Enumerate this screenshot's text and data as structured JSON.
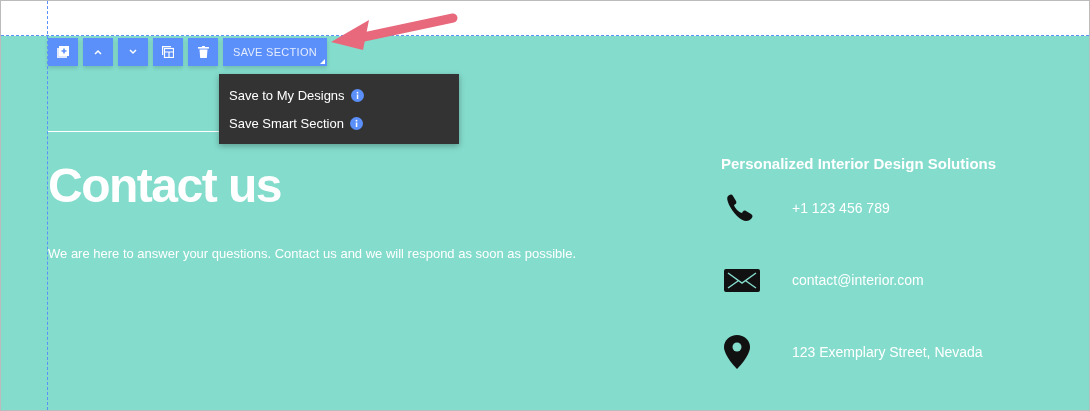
{
  "toolbar": {
    "buttons": [
      {
        "kind": "add"
      },
      {
        "kind": "up"
      },
      {
        "kind": "down"
      },
      {
        "kind": "layout"
      },
      {
        "kind": "delete"
      }
    ],
    "save_button": "SAVE SECTION"
  },
  "save_menu": {
    "items": [
      "Save to My Designs",
      "Save Smart Section"
    ]
  },
  "section": {
    "heading": "Contact us",
    "text": "We are here to answer your questions. Contact us and we will respond as soon as possible.",
    "info_title": "Personalized Interior Design Solutions",
    "contacts": [
      {
        "kind": "phone",
        "text": "+1 123 456 789"
      },
      {
        "kind": "email",
        "text": "contact@interior.com"
      },
      {
        "kind": "location",
        "text": "123 Exemplary Street, Nevada"
      }
    ]
  }
}
